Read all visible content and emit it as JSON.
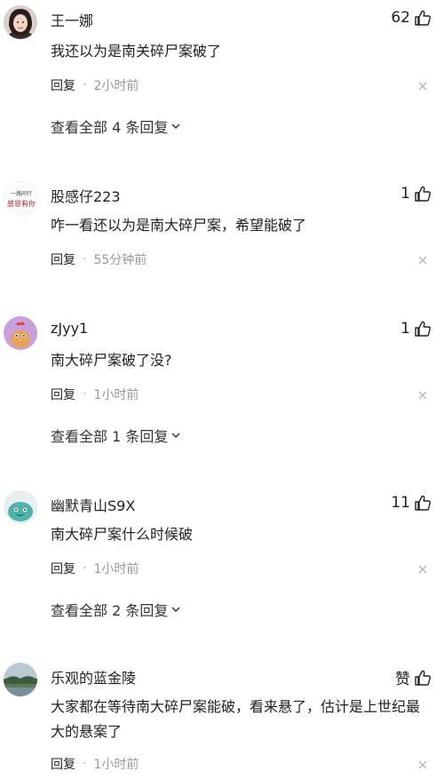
{
  "comments": [
    {
      "username": "王一娜",
      "likes": "62",
      "text": "我还以为是南关碎尸案破了",
      "reply_label": "回复",
      "time": "2小时前",
      "view_all": "查看全部 4 条回复",
      "avatar_icon": "avatar-woman-photo"
    },
    {
      "username": "股感仔223",
      "likes": "1",
      "text": "咋一看还以为是南大碎尸案，希望能破了",
      "reply_label": "回复",
      "time": "55分钟前",
      "avatar_icon": "avatar-calligraphy",
      "avatar_text_line1": "一路同行",
      "avatar_text_line2": "感恩有你"
    },
    {
      "username": "zJyy1",
      "likes": "1",
      "text": "南大碎尸案破了没?",
      "reply_label": "回复",
      "time": "1小时前",
      "view_all": "查看全部 1 条回复",
      "avatar_icon": "avatar-cartoon-chicken"
    },
    {
      "username": "幽默青山S9X",
      "likes": "11",
      "text": "南大碎尸案什么时候破",
      "reply_label": "回复",
      "time": "1小时前",
      "view_all": "查看全部 2 条回复",
      "avatar_icon": "avatar-cartoon-teal"
    },
    {
      "username": "乐观的蓝金陵",
      "likes": "赞",
      "text": "大家都在等待南大碎尸案能破，看来悬了，估计是上世纪最大的悬案了",
      "reply_label": "回复",
      "time": "1小时前",
      "avatar_icon": "avatar-landscape-photo"
    }
  ],
  "colors": {
    "text": "#222222",
    "meta_gray": "#999999",
    "icon_gray": "#b5b5b5"
  }
}
